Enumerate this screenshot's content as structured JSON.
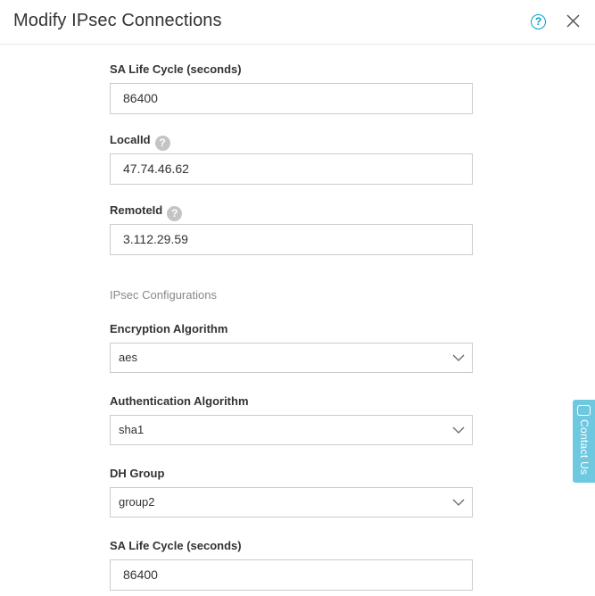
{
  "dialog": {
    "title": "Modify IPsec Connections",
    "help_icon": "help-circle-icon",
    "close_icon": "close-icon"
  },
  "fields": {
    "sa_life_cycle_label": "SA Life Cycle (seconds)",
    "sa_life_cycle_value": "86400",
    "local_id_label": "LocalId",
    "local_id_value": "47.74.46.62",
    "remote_id_label": "RemoteId",
    "remote_id_value": "3.112.29.59"
  },
  "ipsec": {
    "section_title": "IPsec Configurations",
    "encryption_label": "Encryption Algorithm",
    "encryption_value": "aes",
    "auth_label": "Authentication Algorithm",
    "auth_value": "sha1",
    "dh_label": "DH Group",
    "dh_value": "group2",
    "sa_life_cycle_label": "SA Life Cycle (seconds)",
    "sa_life_cycle_value": "86400"
  },
  "tooltip_mark": "?",
  "contact": {
    "label": "Contact Us"
  },
  "colors": {
    "accent": "#00a2ca",
    "contact_tab": "#6ec8e0",
    "border": "#cccccc",
    "help_badge": "#c4c4c4"
  }
}
